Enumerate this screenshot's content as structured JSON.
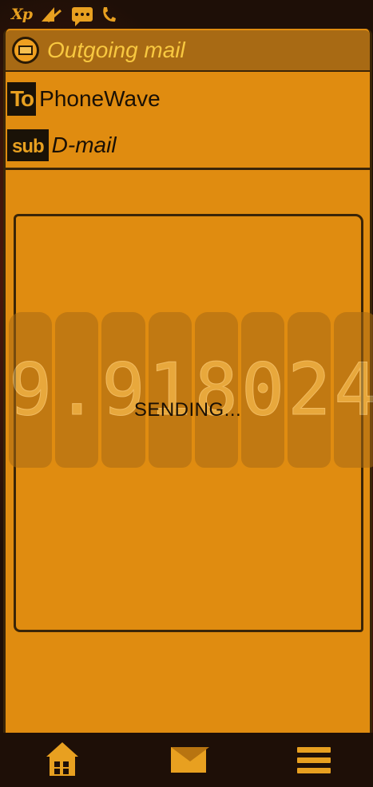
{
  "status_bar": {
    "network_label": "Xp",
    "icons": [
      "xp-icon",
      "signal-icon",
      "sms-icon",
      "phone-icon"
    ]
  },
  "header": {
    "icon": "mail-circle-icon",
    "title": "Outgoing mail"
  },
  "to_field": {
    "tag": "To",
    "value": "PhoneWave"
  },
  "subject_field": {
    "tag": "sub",
    "value": "D-mail"
  },
  "body": {
    "status_text": "SENDING...",
    "meter_digits": [
      "9",
      ".",
      "9",
      "1",
      "8",
      "0",
      "2",
      "4"
    ]
  },
  "bottom_nav": {
    "items": [
      "home-icon",
      "envelope-icon",
      "menu-icon"
    ]
  },
  "colors": {
    "paper": "#e08c10",
    "accent": "#e8a020",
    "ink": "#1a1005",
    "background": "#1e0f07"
  }
}
